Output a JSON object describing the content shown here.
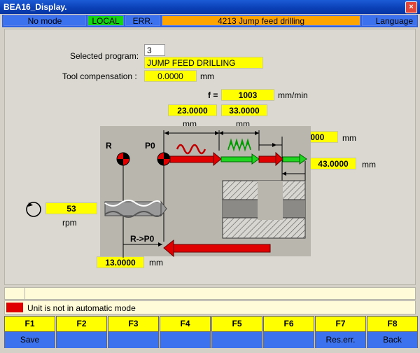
{
  "window": {
    "title": "BEA16_Display.",
    "close_glyph": "×"
  },
  "status": {
    "mode": "No mode",
    "local": "LOCAL",
    "err": "ERR.",
    "message": "4213 Jump feed drilling",
    "language": "Language"
  },
  "program": {
    "selected_label": "Selected program:",
    "number": "3",
    "name": "JUMP FEED DRILLING",
    "tool_comp_label": "Tool compensation :",
    "tool_comp_value": "0.0000",
    "tool_comp_unit": "mm"
  },
  "feed": {
    "label": "f =",
    "value": "1003",
    "unit": "mm/min"
  },
  "dims": {
    "d1": "23.0000",
    "d1_unit": "mm",
    "d2": "33.0000",
    "d2_unit": "mm",
    "d3": "3.0000",
    "d3_unit": "mm",
    "d4": "43.0000",
    "d4_unit": "mm",
    "d5": "13.0000",
    "d5_unit": "mm"
  },
  "spindle": {
    "value": "53",
    "unit": "rpm"
  },
  "diagram_labels": {
    "r": "R",
    "p0": "P0",
    "r_p0": "R->P0"
  },
  "messages": {
    "row1": "",
    "row2": "Unit is not in automatic mode"
  },
  "colors": {
    "yellow": "#FFFF00",
    "blue": "#3D72EE",
    "red": "#E00000",
    "green": "#14D414",
    "orange": "#FFA500"
  },
  "fkeys": [
    {
      "key": "F1",
      "label": "Save"
    },
    {
      "key": "F2",
      "label": ""
    },
    {
      "key": "F3",
      "label": ""
    },
    {
      "key": "F4",
      "label": ""
    },
    {
      "key": "F5",
      "label": ""
    },
    {
      "key": "F6",
      "label": ""
    },
    {
      "key": "F7",
      "label": "Res.err."
    },
    {
      "key": "F8",
      "label": "Back"
    }
  ]
}
